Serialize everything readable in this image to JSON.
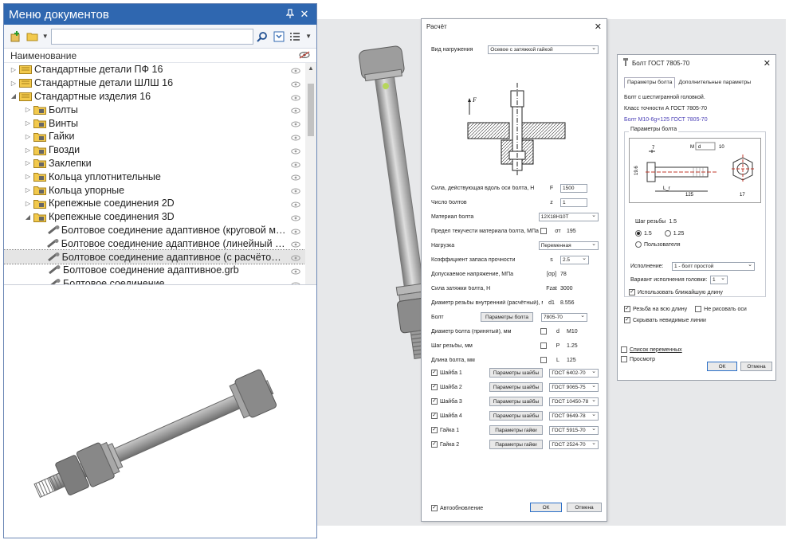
{
  "docs_panel": {
    "title": "Меню документов",
    "pin_icon": "pin-icon",
    "close_label": "✕",
    "search_value": "",
    "column_header": "Наименование",
    "tree": [
      {
        "label": "Стандартные детали ПФ 16",
        "level": 0,
        "expander": "▷",
        "icon": "library-icon"
      },
      {
        "label": "Стандартные детали ШЛШ 16",
        "level": 0,
        "expander": "▷",
        "icon": "library-icon"
      },
      {
        "label": "Стандартные изделия 16",
        "level": 0,
        "expander": "◢",
        "icon": "library-icon"
      },
      {
        "label": "Болты",
        "level": 1,
        "expander": "▷",
        "icon": "folder-bolt-icon"
      },
      {
        "label": "Винты",
        "level": 1,
        "expander": "▷",
        "icon": "folder-screw-icon"
      },
      {
        "label": "Гайки",
        "level": 1,
        "expander": "▷",
        "icon": "folder-nut-icon"
      },
      {
        "label": "Гвозди",
        "level": 1,
        "expander": "▷",
        "icon": "folder-nail-icon"
      },
      {
        "label": "Заклепки",
        "level": 1,
        "expander": "▷",
        "icon": "folder-rivet-icon"
      },
      {
        "label": "Кольца уплотнительные",
        "level": 1,
        "expander": "▷",
        "icon": "folder-ring-icon"
      },
      {
        "label": "Кольца упорные",
        "level": 1,
        "expander": "▷",
        "icon": "folder-ring-icon"
      },
      {
        "label": "Крепежные соединения 2D",
        "level": 1,
        "expander": "▷",
        "icon": "folder-fastener-icon"
      },
      {
        "label": "Крепежные соединения 3D",
        "level": 1,
        "expander": "◢",
        "icon": "folder-fastener-icon"
      },
      {
        "label": "Болтовое соединение адаптивное (круговой масси...",
        "level": 2,
        "expander": "",
        "icon": "bolt-joint-icon"
      },
      {
        "label": "Болтовое соединение адаптивное (линейный масс...",
        "level": 2,
        "expander": "",
        "icon": "bolt-joint-icon"
      },
      {
        "label": "Болтовое соединение адаптивное (с расчётом).grb",
        "level": 2,
        "expander": "",
        "icon": "bolt-joint-icon",
        "selected": true
      },
      {
        "label": "Болтовое соединение адаптивное.grb",
        "level": 2,
        "expander": "",
        "icon": "bolt-joint-icon"
      },
      {
        "label": "Болтовое соединение...",
        "level": 2,
        "expander": "",
        "icon": "bolt-joint-icon"
      }
    ]
  },
  "calc_dialog": {
    "title": "Расчёт",
    "close_label": "✕",
    "load_type_label": "Вид нагружения",
    "load_type_value": "Осевое с затяжкой гайкой",
    "diagram_force_label": "F",
    "rows": [
      {
        "label": "Сила, действующая вдоль оси болта, Н",
        "sym": "F",
        "value": "1500",
        "kind": "input"
      },
      {
        "label": "Число болтов",
        "sym": "z",
        "value": "1",
        "kind": "input"
      },
      {
        "label": "Материал болта",
        "sym": "",
        "value": "12Х18Н10Т",
        "kind": "select"
      },
      {
        "label": "Предел текучести материала болта, МПа",
        "sym": "σт",
        "value": "195",
        "kind": "check"
      },
      {
        "label": "Нагрузка",
        "sym": "",
        "value": "Переменная",
        "kind": "select"
      },
      {
        "label": "Коэффициент запаса прочности",
        "sym": "s",
        "value": "2.5",
        "kind": "select"
      },
      {
        "label": "Допускаемое напряжение, МПа",
        "sym": "[σр]",
        "value": "78",
        "kind": "text"
      },
      {
        "label": "Сила затяжки болта, Н",
        "sym": "Fzat",
        "value": "3000",
        "kind": "text"
      },
      {
        "label": "Диаметр резьбы внутренний (расчётный), мм",
        "sym": "d1",
        "value": "8.556",
        "kind": "text"
      },
      {
        "label": "Болт",
        "sym": "",
        "value": "7805-70",
        "kind": "button",
        "button": "Параметры болта"
      },
      {
        "label": "Диаметр болта (принятый), мм",
        "sym": "d",
        "value": "M10",
        "kind": "check"
      },
      {
        "label": "Шаг резьбы, мм",
        "sym": "P",
        "value": "1.25",
        "kind": "check"
      },
      {
        "label": "Длина болта, мм",
        "sym": "L",
        "value": "125",
        "kind": "check"
      }
    ],
    "parts": [
      {
        "label": "Шайба 1",
        "button": "Параметры шайбы",
        "value": "ГОСТ 6402-70"
      },
      {
        "label": "Шайба 2",
        "button": "Параметры шайбы",
        "value": "ГОСТ 9065-75"
      },
      {
        "label": "Шайба 3",
        "button": "Параметры шайбы",
        "value": "ГОСТ 10450-78"
      },
      {
        "label": "Шайба 4",
        "button": "Параметры шайбы",
        "value": "ГОСТ 9649-78"
      },
      {
        "label": "Гайка 1",
        "button": "Параметры гайки",
        "value": "ГОСТ 5915-70"
      },
      {
        "label": "Гайка 2",
        "button": "Параметры гайки",
        "value": "ГОСТ 2524-70"
      }
    ],
    "auto_update_label": "Автообновление",
    "ok_label": "ОК",
    "cancel_label": "Отмена"
  },
  "bolt_dialog": {
    "title": "Болт ГОСТ 7805-70",
    "close_label": "✕",
    "tab_params": "Параметры болта",
    "tab_extra": "Дополнительные параметры",
    "desc_line1": "Болт с шестигранной головкой.",
    "desc_line2": "Класс точности А ГОСТ 7805-70",
    "designation": "Болт М10-6g×125 ГОСТ 7805-70",
    "group_label": "Параметры болта",
    "dims": {
      "head_h": "7",
      "m_label": "M",
      "d_value": "d",
      "d_num": "10",
      "dim_19": "19.6",
      "l_label": "L_r",
      "l_value": "125",
      "dim_17": "17"
    },
    "pitch_label": "Шаг резьбы",
    "pitch_value": "1.5",
    "pitch_opt1": "1.5",
    "pitch_opt2": "1.25",
    "pitch_opt3": "Пользователя",
    "exec_label": "Исполнение:",
    "exec_value": "1 - болт простой",
    "head_var_label": "Вариант исполнения головки:",
    "head_var_value": "1",
    "nearest_label": "Использовать ближайшую длину",
    "thread_full_label": "Резьба на всю длину",
    "no_axes_label": "Не рисовать оси",
    "hide_lines_label": "Скрывать невидимые линии",
    "vars_label": "Список переменных",
    "preview_label": "Просмотр",
    "ok_label": "ОК",
    "cancel_label": "Отмена"
  }
}
